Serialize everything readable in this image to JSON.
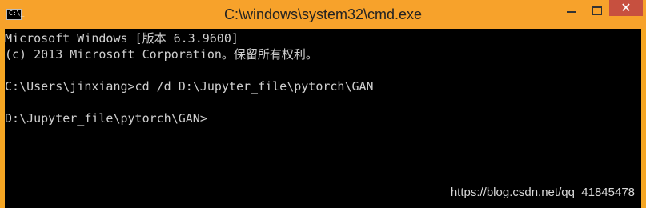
{
  "window": {
    "title": "C:\\windows\\system32\\cmd.exe",
    "icon": "cmd-icon",
    "icon_text": "C:\\_",
    "controls": {
      "minimize_icon": "minimize-icon",
      "maximize_icon": "maximize-icon",
      "close_label": "✕"
    }
  },
  "console": {
    "lines": [
      "Microsoft Windows [版本 6.3.9600]",
      "(c) 2013 Microsoft Corporation。保留所有权利。",
      "",
      "C:\\Users\\jinxiang>cd /d D:\\Jupyter_file\\pytorch\\GAN",
      "",
      "D:\\Jupyter_file\\pytorch\\GAN>"
    ]
  },
  "watermark": "https://blog.csdn.net/qq_41845478",
  "colors": {
    "titlebar": "#f7a22b",
    "close_button": "#c7503f",
    "console_background": "#000000",
    "console_text": "#cfcfcf"
  }
}
